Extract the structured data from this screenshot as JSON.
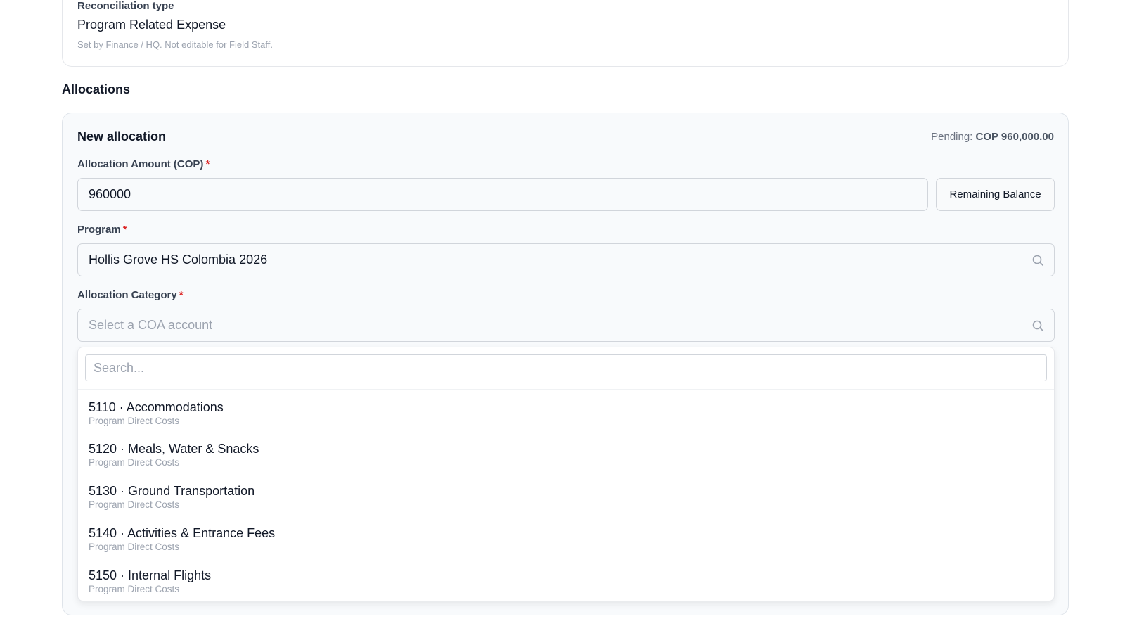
{
  "reconciliation": {
    "label": "Reconciliation type",
    "value": "Program Related Expense",
    "help": "Set by Finance / HQ. Not editable for Field Staff."
  },
  "allocations": {
    "section_title": "Allocations",
    "card_title": "New allocation",
    "pending_label": "Pending:",
    "pending_value": "COP 960,000.00",
    "amount": {
      "label": "Allocation Amount (COP)",
      "required_mark": "*",
      "value": "960000",
      "remaining_button": "Remaining Balance"
    },
    "program": {
      "label": "Program",
      "required_mark": "*",
      "value": "Hollis Grove HS Colombia 2026",
      "icon": "search-icon"
    },
    "category": {
      "label": "Allocation Category",
      "required_mark": "*",
      "placeholder": "Select a COA account",
      "icon": "search-icon"
    },
    "dropdown": {
      "search_placeholder": "Search...",
      "options": [
        {
          "title": "5110 · Accommodations",
          "subtitle": "Program Direct Costs"
        },
        {
          "title": "5120 · Meals, Water & Snacks",
          "subtitle": "Program Direct Costs"
        },
        {
          "title": "5130 · Ground Transportation",
          "subtitle": "Program Direct Costs"
        },
        {
          "title": "5140 · Activities & Entrance Fees",
          "subtitle": "Program Direct Costs"
        },
        {
          "title": "5150 · Internal Flights",
          "subtitle": "Program Direct Costs"
        }
      ]
    }
  },
  "colors": {
    "required": "#dc2626",
    "card_background": "#f8fafc",
    "border": "#d1d5db"
  }
}
